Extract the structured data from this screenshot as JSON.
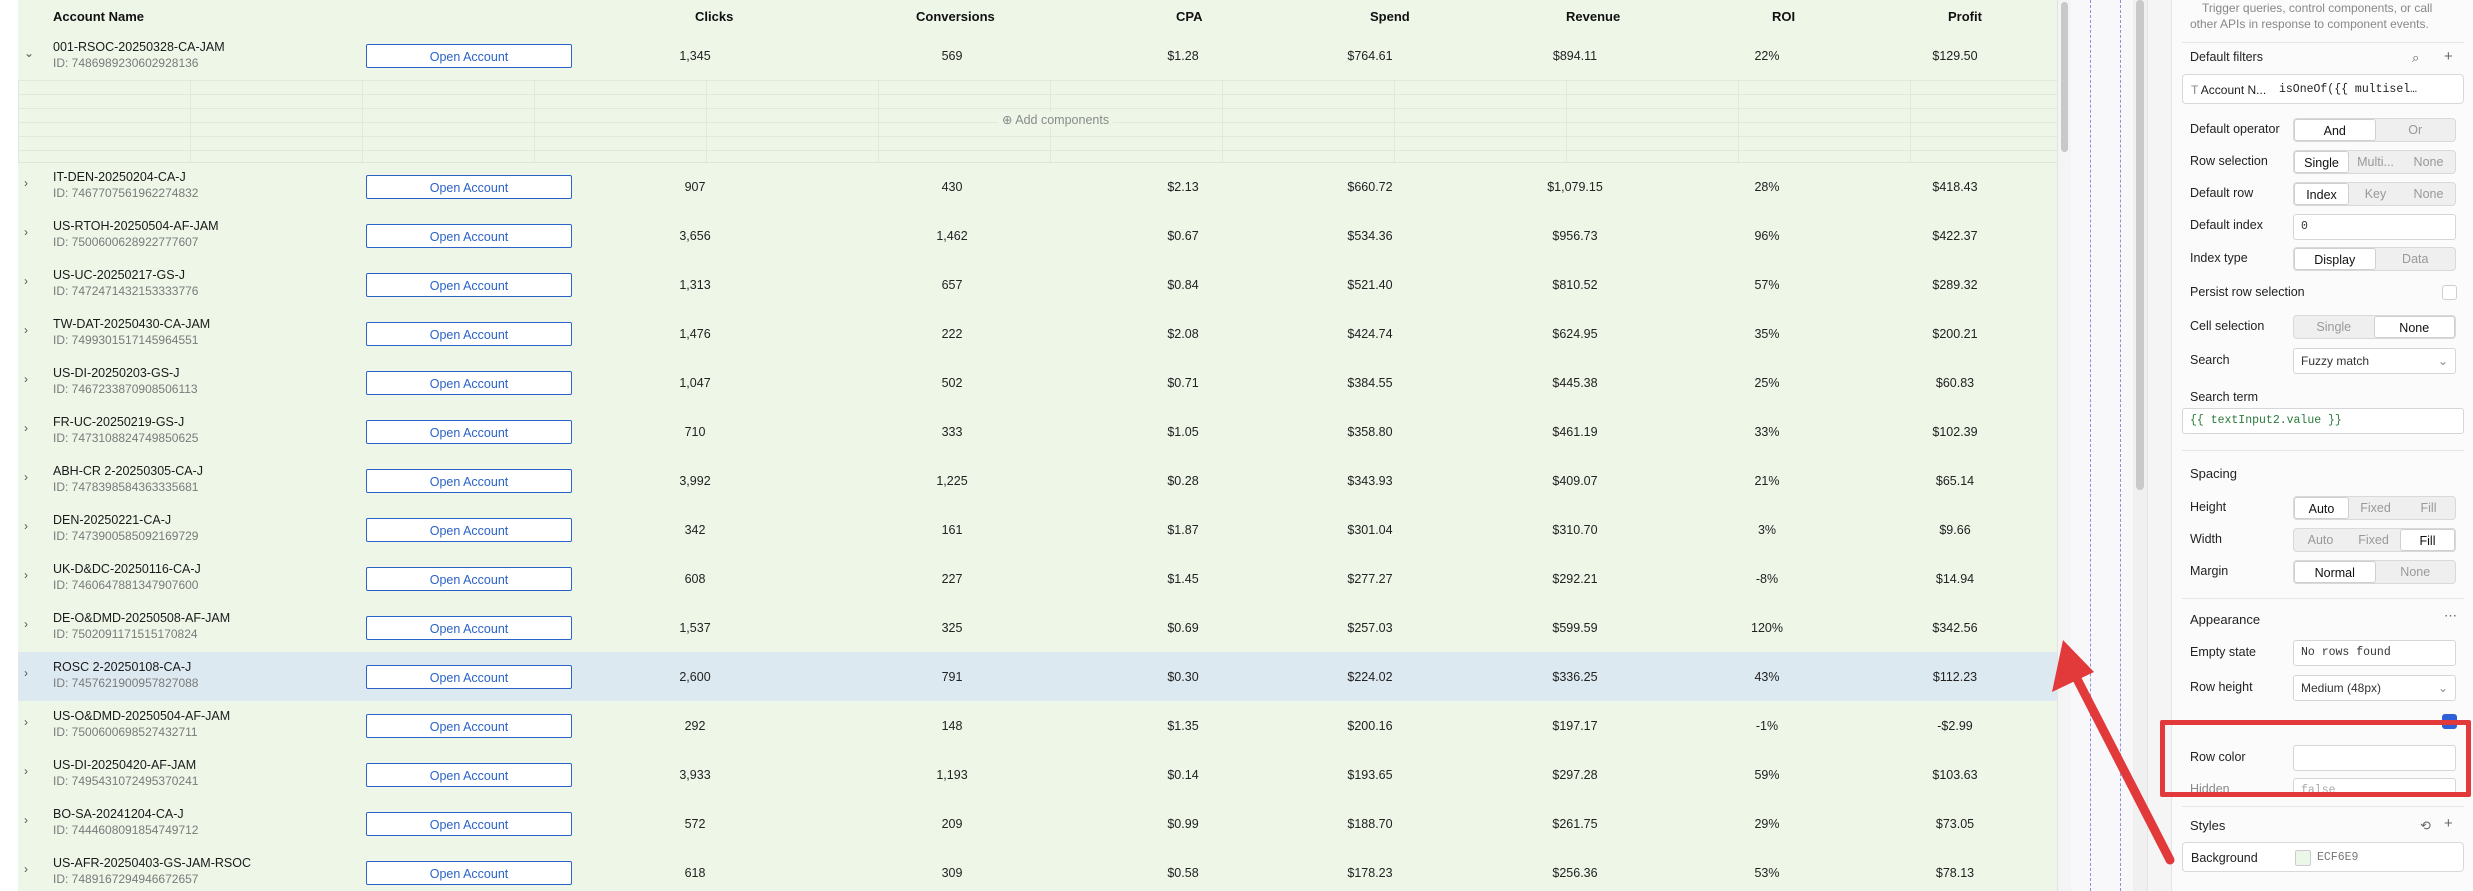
{
  "table": {
    "headers": {
      "account_name": "Account Name",
      "clicks": "Clicks",
      "conversions": "Conversions",
      "cpa": "CPA",
      "spend": "Spend",
      "revenue": "Revenue",
      "roi": "ROI",
      "profit": "Profit"
    },
    "open_label": "Open Account",
    "add_components_label": "Add components",
    "rows": [
      {
        "name": "001-RSOC-20250328-CA-JAM",
        "id": "ID: 7486989230602928136",
        "clicks": "1,345",
        "conversions": "569",
        "cpa": "$1.28",
        "spend": "$764.61",
        "revenue": "$894.11",
        "roi": "22%",
        "profit": "$129.50"
      },
      {
        "name": "IT-DEN-20250204-CA-J",
        "id": "ID: 7467707561962274832",
        "clicks": "907",
        "conversions": "430",
        "cpa": "$2.13",
        "spend": "$660.72",
        "revenue": "$1,079.15",
        "roi": "28%",
        "profit": "$418.43"
      },
      {
        "name": "US-RTOH-20250504-AF-JAM",
        "id": "ID: 7500600628922777607",
        "clicks": "3,656",
        "conversions": "1,462",
        "cpa": "$0.67",
        "spend": "$534.36",
        "revenue": "$956.73",
        "roi": "96%",
        "profit": "$422.37"
      },
      {
        "name": "US-UC-20250217-GS-J",
        "id": "ID: 7472471432153333776",
        "clicks": "1,313",
        "conversions": "657",
        "cpa": "$0.84",
        "spend": "$521.40",
        "revenue": "$810.52",
        "roi": "57%",
        "profit": "$289.32"
      },
      {
        "name": "TW-DAT-20250430-CA-JAM",
        "id": "ID: 7499301517145964551",
        "clicks": "1,476",
        "conversions": "222",
        "cpa": "$2.08",
        "spend": "$424.74",
        "revenue": "$624.95",
        "roi": "35%",
        "profit": "$200.21"
      },
      {
        "name": "US-DI-20250203-GS-J",
        "id": "ID: 7467233870908506113",
        "clicks": "1,047",
        "conversions": "502",
        "cpa": "$0.71",
        "spend": "$384.55",
        "revenue": "$445.38",
        "roi": "25%",
        "profit": "$60.83"
      },
      {
        "name": "FR-UC-20250219-GS-J",
        "id": "ID: 7473108824749850625",
        "clicks": "710",
        "conversions": "333",
        "cpa": "$1.05",
        "spend": "$358.80",
        "revenue": "$461.19",
        "roi": "33%",
        "profit": "$102.39"
      },
      {
        "name": "ABH-CR 2-20250305-CA-J",
        "id": "ID: 7478398584363335681",
        "clicks": "3,992",
        "conversions": "1,225",
        "cpa": "$0.28",
        "spend": "$343.93",
        "revenue": "$409.07",
        "roi": "21%",
        "profit": "$65.14"
      },
      {
        "name": "DEN-20250221-CA-J",
        "id": "ID: 7473900585092169729",
        "clicks": "342",
        "conversions": "161",
        "cpa": "$1.87",
        "spend": "$301.04",
        "revenue": "$310.70",
        "roi": "3%",
        "profit": "$9.66"
      },
      {
        "name": "UK-D&DC-20250116-CA-J",
        "id": "ID: 7460647881347907600",
        "clicks": "608",
        "conversions": "227",
        "cpa": "$1.45",
        "spend": "$277.27",
        "revenue": "$292.21",
        "roi": "-8%",
        "profit": "$14.94"
      },
      {
        "name": "DE-O&DMD-20250508-AF-JAM",
        "id": "ID: 7502091171515170824",
        "clicks": "1,537",
        "conversions": "325",
        "cpa": "$0.69",
        "spend": "$257.03",
        "revenue": "$599.59",
        "roi": "120%",
        "profit": "$342.56"
      },
      {
        "name": "ROSC 2-20250108-CA-J",
        "id": "ID: 7457621900957827088",
        "clicks": "2,600",
        "conversions": "791",
        "cpa": "$0.30",
        "spend": "$224.02",
        "revenue": "$336.25",
        "roi": "43%",
        "profit": "$112.23"
      },
      {
        "name": "US-O&DMD-20250504-AF-JAM",
        "id": "ID: 7500600698527432711",
        "clicks": "292",
        "conversions": "148",
        "cpa": "$1.35",
        "spend": "$200.16",
        "revenue": "$197.17",
        "roi": "-1%",
        "profit": "-$2.99"
      },
      {
        "name": "US-DI-20250420-AF-JAM",
        "id": "ID: 7495431072495370241",
        "clicks": "3,933",
        "conversions": "1,193",
        "cpa": "$0.14",
        "spend": "$193.65",
        "revenue": "$297.28",
        "roi": "59%",
        "profit": "$103.63"
      },
      {
        "name": "BO-SA-20241204-CA-J",
        "id": "ID: 7444608091854749712",
        "clicks": "572",
        "conversions": "209",
        "cpa": "$0.99",
        "spend": "$188.70",
        "revenue": "$261.75",
        "roi": "29%",
        "profit": "$73.05"
      },
      {
        "name": "US-AFR-20250403-GS-JAM-RSOC",
        "id": "ID: 7489167294946672657",
        "clicks": "618",
        "conversions": "309",
        "cpa": "$0.58",
        "spend": "$178.23",
        "revenue": "$256.36",
        "roi": "53%",
        "profit": "$78.13"
      }
    ],
    "selected_row": 11
  },
  "panel": {
    "top_text_1": "Trigger queries, control components, or call",
    "top_text_2": "other APIs in response to component events.",
    "default_filters": {
      "label": "Default filters",
      "field": "Account N...",
      "expr": "isOneOf({{ multisel…"
    },
    "default_operator": {
      "label": "Default operator",
      "options": [
        "And",
        "Or"
      ],
      "selected": "And"
    },
    "row_selection": {
      "label": "Row selection",
      "options": [
        "Single",
        "Multi...",
        "None"
      ],
      "selected": "Single"
    },
    "default_row": {
      "label": "Default row",
      "options": [
        "Index",
        "Key",
        "None"
      ],
      "selected": "Index"
    },
    "default_index": {
      "label": "Default index",
      "value": "0"
    },
    "index_type": {
      "label": "Index type",
      "options": [
        "Display",
        "Data"
      ],
      "selected": "Display"
    },
    "persist_row_selection": {
      "label": "Persist row selection"
    },
    "cell_selection": {
      "label": "Cell selection",
      "options": [
        "Single",
        "None"
      ],
      "selected": "None"
    },
    "search": {
      "label": "Search",
      "value": "Fuzzy match"
    },
    "search_term": {
      "label": "Search term",
      "value": "{{ textInput2.value }}"
    },
    "spacing": {
      "title": "Spacing"
    },
    "height": {
      "label": "Height",
      "options": [
        "Auto",
        "Fixed",
        "Fill"
      ],
      "selected": "Auto"
    },
    "width": {
      "label": "Width",
      "options": [
        "Auto",
        "Fixed",
        "Fill"
      ],
      "selected": "Fill"
    },
    "margin": {
      "label": "Margin",
      "options": [
        "Normal",
        "None"
      ],
      "selected": "Normal"
    },
    "appearance": {
      "title": "Appearance"
    },
    "empty_state": {
      "label": "Empty state",
      "value": "No rows found"
    },
    "row_height": {
      "label": "Row height",
      "value": "Medium (48px)"
    },
    "row_color": {
      "label": "Row color",
      "value": ""
    },
    "hidden": {
      "label": "Hidden",
      "value": "false"
    },
    "styles": {
      "title": "Styles"
    },
    "background": {
      "label": "Background",
      "value": "ECF6E9",
      "swatch": "#ECF6E9"
    }
  },
  "colors": {
    "row_bg": "#eef6e8",
    "selected_row_bg": "#dde9f1",
    "button_blue": "#2a62c8",
    "annotation_red": "#e23a3a"
  },
  "icons": {
    "expand": "chevron-right-icon",
    "collapse": "chevron-down-icon",
    "add": "plus-icon",
    "arrow": "annotation-arrow"
  }
}
